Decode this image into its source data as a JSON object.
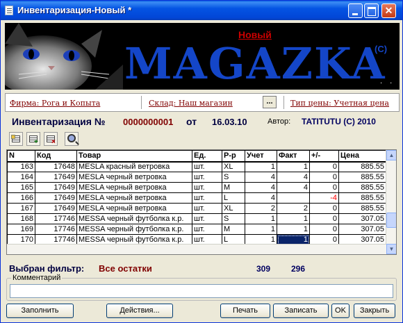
{
  "window": {
    "title": "Инвентаризация-Новый *"
  },
  "banner": {
    "status": "Новый",
    "brand": "MAGAZKA",
    "copyright": "(C)",
    "dots": ". ."
  },
  "info": {
    "firm": "Фирма: Рога и Копыта",
    "warehouse": "Склад: Наш магазин",
    "select_btn": "...",
    "price_type": "Тип цены: Учетная цена"
  },
  "document": {
    "title": "Инвентаризация №",
    "number": "0000000001",
    "from": "от",
    "date": "16.03.10",
    "author_label": "Автор:",
    "author": "TATITUTU (C) 2010"
  },
  "toolbar": {
    "icons": [
      "list-icon",
      "add-row-icon",
      "delete-row-icon",
      "search-icon"
    ]
  },
  "table": {
    "columns": [
      "N",
      "Код",
      "Товар",
      "Ед.",
      "Р-р",
      "Учет",
      "Факт",
      "+/-",
      "Цена"
    ],
    "rows": [
      [
        "163",
        "17648",
        "MESLA красный ветровка",
        "шт.",
        "XL",
        "1",
        "1",
        "0",
        "885.55"
      ],
      [
        "164",
        "17649",
        "MESLA черный ветровка",
        "шт.",
        "S",
        "4",
        "4",
        "0",
        "885.55"
      ],
      [
        "165",
        "17649",
        "MESLA черный ветровка",
        "шт.",
        "M",
        "4",
        "4",
        "0",
        "885.55"
      ],
      [
        "166",
        "17649",
        "MESLA черный ветровка",
        "шт.",
        "L",
        "4",
        "",
        "-4",
        "885.55"
      ],
      [
        "167",
        "17649",
        "MESLA черный ветровка",
        "шт.",
        "XL",
        "2",
        "2",
        "0",
        "885.55"
      ],
      [
        "168",
        "17746",
        "MESSA черный футболка к.р.",
        "шт.",
        "S",
        "1",
        "1",
        "0",
        "307.05"
      ],
      [
        "169",
        "17746",
        "MESSA черный футболка к.р.",
        "шт.",
        "M",
        "1",
        "1",
        "0",
        "307.05"
      ],
      [
        "170",
        "17746",
        "MESSA черный футболка к.р.",
        "шт.",
        "L",
        "1",
        "1",
        "0",
        "307.05"
      ]
    ]
  },
  "footer": {
    "filter_label": "Выбран фильтр:",
    "filter_value": "Все остатки",
    "total_account": "309",
    "total_fact": "296",
    "comment_label": "Комментарий",
    "comment_value": ""
  },
  "buttons": {
    "fill": "Заполнить",
    "actions": "Действия...",
    "print": "Печать",
    "save": "Записать",
    "ok": "OK",
    "close": "Закрыть"
  },
  "colors": {
    "titlebar": "#0454e3",
    "brand": "#1446c8",
    "accent_red": "#800000",
    "selection": "#0a246a"
  }
}
